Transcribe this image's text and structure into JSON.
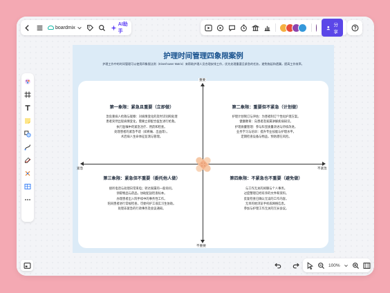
{
  "toolbar": {
    "brand": "boardmix",
    "ai_label": "AI助手",
    "share_label": "分享"
  },
  "zoom": "100%",
  "board": {
    "title": "护理时间管理四象限案例",
    "description": "护理工作中的时间管理可以使用四象限法则（Eisenhower Matrix）来帮助护理人员合理安排工作，优先处理重要且紧急的任务，避免拖延和遗漏，提高工作效率。"
  },
  "axes": {
    "top": "重要",
    "bottom": "不重要",
    "left": "紧急",
    "right": "不紧急"
  },
  "quadrants": {
    "q1": {
      "title": "第一象限：紧急且重要（立即做）",
      "lines": [
        "急危重病人抢救与观察：对病情变化的及时识别和处理",
        "患者突然出现病情变化，需要立即配合医生进行抢救。",
        "执行医嘱中的紧急治疗、用药和检查。",
        "处理患者的紧急不适（如疼痛、出血等）。",
        "术后病人生命体征监测与管理。"
      ]
    },
    "q2": {
      "title": "第二象限：重要但不紧急（计划做）",
      "lines": [
        "护理计划制订与评估：为患者制订个性化护理方案。",
        "健康教育：向患者及家属讲解疾病知识。",
        "护理质量管理：参与科室质量改进与持续改进。",
        "业务学习与培训：提升专业技能与护理水平。",
        "定期检查设备与物品，预防潜在风险。"
      ]
    },
    "q3": {
      "title": "第三象限：紧急但不重要（委托他人做）",
      "lines": [
        "接听电话与处理日常来电；转达家属的一般询问。",
        "领取物品与药品，协助配送检查标本。",
        "办理患者出入院手续中的事务性工作。",
        "陪同患者进行常规检查，可委托护工或实习生协助。",
        "处理非紧急的行政事务及会议通知。"
      ]
    },
    "q4": {
      "title": "第四象限：不紧急也不重要（避免做）",
      "lines": [
        "与工作无关的闲聊与个人事务。",
        "过度整理已经有序的文件和资料。",
        "反复检查已确认无误的工作内容。",
        "无目的地浏览手机或网络信息。",
        "参加与护理工作无关的冗长会议。"
      ]
    }
  }
}
